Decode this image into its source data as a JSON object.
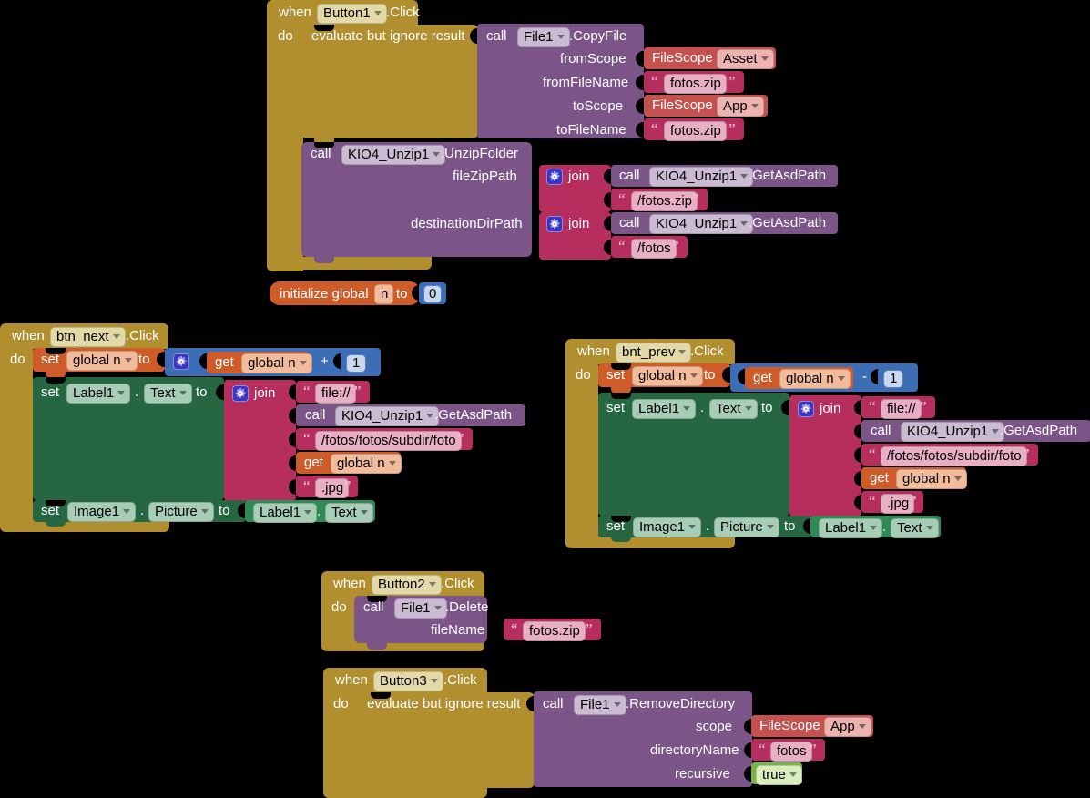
{
  "editor": {
    "name": "MIT App Inventor Blocks Editor",
    "background": "#000000"
  },
  "colors": {
    "event_gold": "#B18E2E",
    "call_purple": "#7B5488",
    "text_magenta": "#B52E5E",
    "filescope_red": "#C4514E",
    "variable_orange": "#CF5C28",
    "setter_green": "#266742",
    "component_green": "#2E8B57",
    "math_blue": "#3D6DB5",
    "logic_green": "#7BB442",
    "gear_blue": "#3B34C4"
  },
  "labels": {
    "when": "when",
    "do": "do",
    "call": "call",
    "set": "set",
    "get": "get",
    "to": "to",
    "join": "join",
    "dot": ".",
    "plus": "+",
    "minus": "-",
    "evaluate_but_ignore": "evaluate but ignore result",
    "initialize_global": "initialize global",
    "quote_open": "“",
    "quote_close": "”"
  },
  "blocks": {
    "button1_click": {
      "event_component": "Button1",
      "event_name": ".Click",
      "body": {
        "evaluate_label": "evaluate but ignore result",
        "copyfile": {
          "call": "call",
          "component": "File1",
          "method": ".CopyFile",
          "args": [
            {
              "name": "fromScope",
              "value_type": "filescope",
              "value": "FileScope",
              "option": "Asset"
            },
            {
              "name": "fromFileName",
              "value_type": "text",
              "value": "fotos.zip"
            },
            {
              "name": "toScope",
              "value_type": "filescope",
              "value": "FileScope",
              "option": "App"
            },
            {
              "name": "toFileName",
              "value_type": "text",
              "value": "fotos.zip"
            }
          ]
        },
        "unzip": {
          "call": "call",
          "component": "KIO4_Unzip1",
          "method": ".UnzipFolder",
          "args": [
            {
              "name": "fileZipPath",
              "value_type": "join",
              "join_label": "join",
              "items": [
                {
                  "type": "call",
                  "call": "call",
                  "component": "KIO4_Unzip1",
                  "method": ".GetAsdPath"
                },
                {
                  "type": "text",
                  "value": "/fotos.zip"
                }
              ]
            },
            {
              "name": "destinationDirPath",
              "value_type": "join",
              "join_label": "join",
              "items": [
                {
                  "type": "call",
                  "call": "call",
                  "component": "KIO4_Unzip1",
                  "method": ".GetAsdPath"
                },
                {
                  "type": "text",
                  "value": "/fotos"
                }
              ]
            }
          ]
        }
      }
    },
    "init_global": {
      "label": "initialize global",
      "var_name": "n",
      "to": "to",
      "value": "0"
    },
    "btn_next_click": {
      "event_component": "btn_next",
      "event_name": ".Click",
      "set_global": {
        "set": "set",
        "var": "global n",
        "to": "to",
        "math_op": "+",
        "left": {
          "get": "get",
          "var": "global n"
        },
        "right": "1"
      },
      "set_label_text": {
        "set": "set",
        "component": "Label1",
        "property": "Text",
        "to": "to",
        "join_label": "join",
        "items": [
          {
            "type": "text",
            "value": "file://"
          },
          {
            "type": "call",
            "call": "call",
            "component": "KIO4_Unzip1",
            "method": ".GetAsdPath"
          },
          {
            "type": "text",
            "value": "/fotos/fotos/subdir/foto"
          },
          {
            "type": "get",
            "get": "get",
            "var": "global n"
          },
          {
            "type": "text",
            "value": ".jpg"
          }
        ]
      },
      "set_image_picture": {
        "set": "set",
        "component": "Image1",
        "property": "Picture",
        "to": "to",
        "value_component": "Label1",
        "value_property": "Text"
      }
    },
    "bnt_prev_click": {
      "event_component": "bnt_prev",
      "event_name": ".Click",
      "set_global": {
        "set": "set",
        "var": "global n",
        "to": "to",
        "math_op": "-",
        "left": {
          "get": "get",
          "var": "global n"
        },
        "right": "1"
      },
      "set_label_text": {
        "set": "set",
        "component": "Label1",
        "property": "Text",
        "to": "to",
        "join_label": "join",
        "items": [
          {
            "type": "text",
            "value": "file://"
          },
          {
            "type": "call",
            "call": "call",
            "component": "KIO4_Unzip1",
            "method": ".GetAsdPath"
          },
          {
            "type": "text",
            "value": "/fotos/fotos/subdir/foto"
          },
          {
            "type": "get",
            "get": "get",
            "var": "global n"
          },
          {
            "type": "text",
            "value": ".jpg"
          }
        ]
      },
      "set_image_picture": {
        "set": "set",
        "component": "Image1",
        "property": "Picture",
        "to": "to",
        "value_component": "Label1",
        "value_property": "Text"
      }
    },
    "button2_click": {
      "event_component": "Button2",
      "event_name": ".Click",
      "delete": {
        "call": "call",
        "component": "File1",
        "method": ".Delete",
        "args": [
          {
            "name": "fileName",
            "value_type": "text",
            "value": "fotos.zip"
          }
        ]
      }
    },
    "button3_click": {
      "event_component": "Button3",
      "event_name": ".Click",
      "evaluate_label": "evaluate but ignore result",
      "removedir": {
        "call": "call",
        "component": "File1",
        "method": ".RemoveDirectory",
        "args": [
          {
            "name": "scope",
            "value_type": "filescope",
            "value": "FileScope",
            "option": "App"
          },
          {
            "name": "directoryName",
            "value_type": "text",
            "value": "fotos"
          },
          {
            "name": "recursive",
            "value_type": "logic",
            "value": "true"
          }
        ]
      }
    }
  }
}
